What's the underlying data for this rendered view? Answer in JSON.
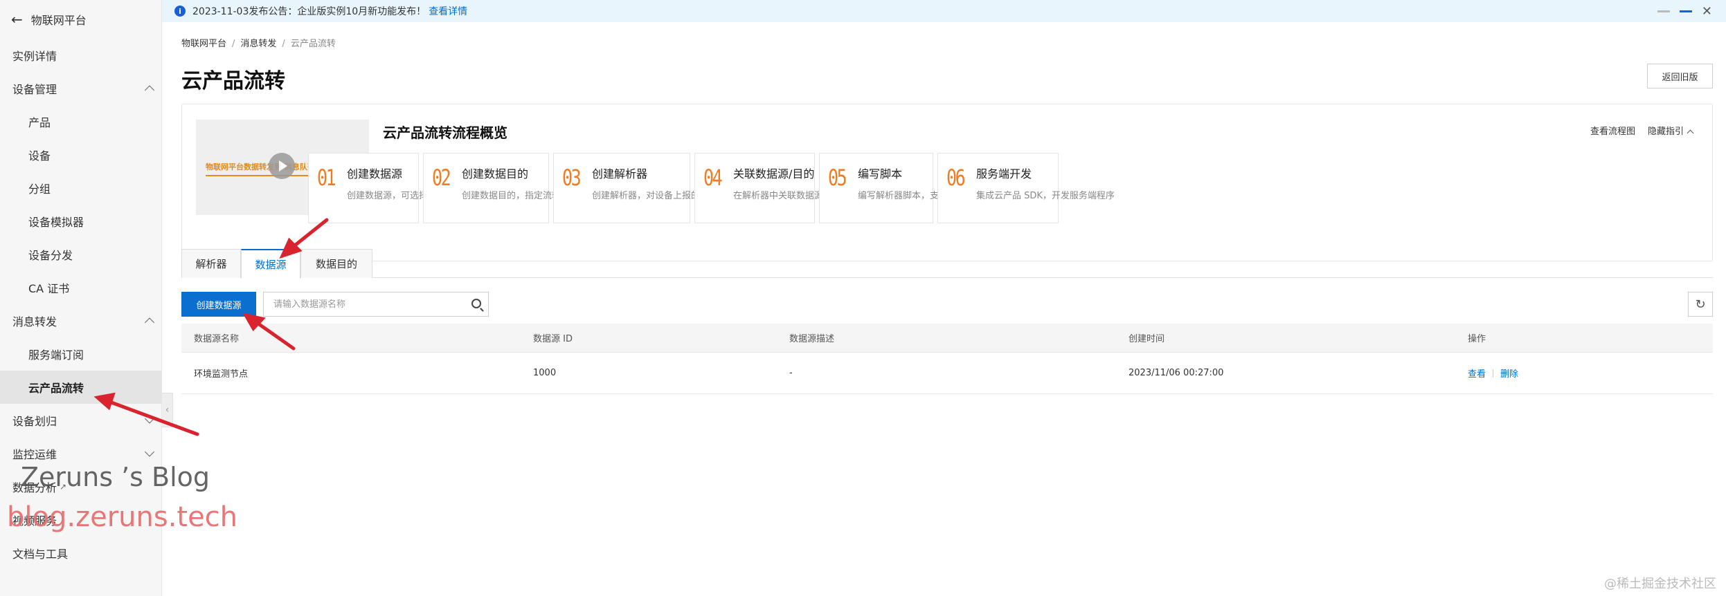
{
  "sidebar": {
    "header": "物联网平台",
    "items": [
      {
        "label": "实例详情",
        "type": "top"
      },
      {
        "label": "设备管理",
        "type": "group",
        "expanded": true
      },
      {
        "label": "产品",
        "type": "sub"
      },
      {
        "label": "设备",
        "type": "sub"
      },
      {
        "label": "分组",
        "type": "sub"
      },
      {
        "label": "设备模拟器",
        "type": "sub"
      },
      {
        "label": "设备分发",
        "type": "sub"
      },
      {
        "label": "CA 证书",
        "type": "sub"
      },
      {
        "label": "消息转发",
        "type": "group",
        "expanded": true
      },
      {
        "label": "服务端订阅",
        "type": "sub"
      },
      {
        "label": "云产品流转",
        "type": "sub",
        "active": true
      },
      {
        "label": "设备划归",
        "type": "group",
        "expanded": false
      },
      {
        "label": "监控运维",
        "type": "group",
        "expanded": false
      },
      {
        "label": "数据分析",
        "type": "external"
      },
      {
        "label": "视频服务",
        "type": "top"
      },
      {
        "label": "文档与工具",
        "type": "top"
      }
    ]
  },
  "notice": {
    "text": "2023-11-03发布公告：企业版实例10月新功能发布！",
    "link": "查看详情"
  },
  "breadcrumb": [
    "物联网平台",
    "消息转发",
    "云产品流转"
  ],
  "page_title": "云产品流转",
  "back_old_button": "返回旧版",
  "overview": {
    "title": "云产品流转流程概览",
    "video_text": "物联网平台数据转发到 消息队列RocketMQ",
    "link_flowchart": "查看流程图",
    "link_hide": "隐藏指引",
    "steps": [
      {
        "num": "01",
        "title": "创建数据源",
        "desc": "创建数据源，可选择多个Topic"
      },
      {
        "num": "02",
        "title": "创建数据目的",
        "desc": "创建数据目的，指定流转到的云产品"
      },
      {
        "num": "03",
        "title": "创建解析器",
        "desc": "创建解析器，对设备上报的数据进行解析"
      },
      {
        "num": "04",
        "title": "关联数据源/目的",
        "desc": "在解析器中关联数据源和数据目的"
      },
      {
        "num": "05",
        "title": "编写脚本",
        "desc": "编写解析器脚本，支持内置函数"
      },
      {
        "num": "06",
        "title": "服务端开发",
        "desc": "集成云产品 SDK，开发服务端程序"
      }
    ]
  },
  "tabs": [
    {
      "label": "解析器",
      "active": false
    },
    {
      "label": "数据源",
      "active": true
    },
    {
      "label": "数据目的",
      "active": false
    }
  ],
  "toolbar": {
    "create_button": "创建数据源",
    "search_placeholder": "请输入数据源名称",
    "search_value": ""
  },
  "table": {
    "columns": [
      "数据源名称",
      "数据源 ID",
      "数据源描述",
      "创建时间",
      "操作"
    ],
    "rows": [
      {
        "name": "环境监测节点",
        "id": "1000",
        "desc": "-",
        "created": "2023/11/06 00:27:00",
        "actions": [
          "查看",
          "删除"
        ]
      }
    ]
  },
  "watermarks": {
    "blog_title": "Zeruns ’s Blog",
    "blog_url": "blog.zeruns.tech",
    "corner": "@稀土掘金技术社区"
  },
  "colors": {
    "primary": "#0a6fcf",
    "link": "#0070cc",
    "step_number": "#ef7b22",
    "annotation_arrow": "#d9232e",
    "notice_bg": "#e8f5fd"
  }
}
